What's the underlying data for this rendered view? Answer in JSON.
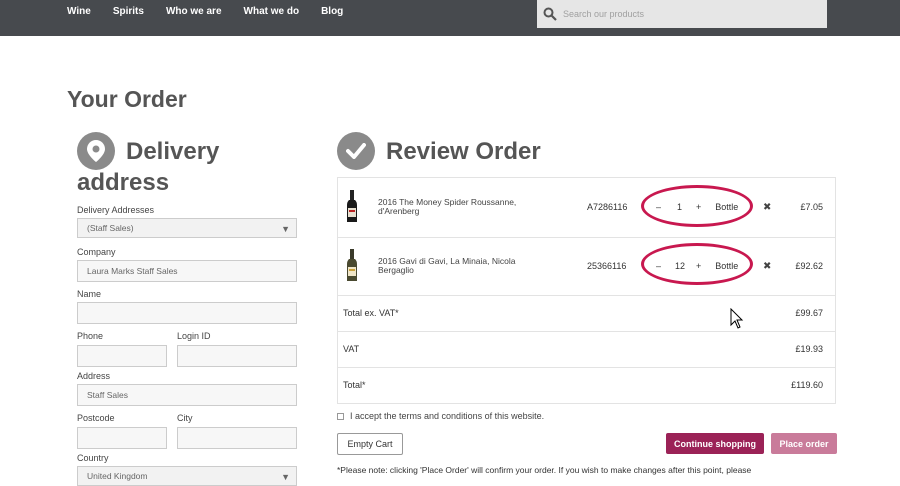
{
  "nav": {
    "items": [
      "Wine",
      "Spirits",
      "Who we are",
      "What we do",
      "Blog"
    ],
    "search_placeholder": "Search our products"
  },
  "page_title": "Your Order",
  "delivery": {
    "title_line1": "Delivery",
    "title_line2": "address",
    "addresses_label": "Delivery Addresses",
    "addresses_value": "(Staff Sales)",
    "company_label": "Company",
    "company_value": "Laura Marks Staff Sales",
    "name_label": "Name",
    "name_value": "",
    "phone_label": "Phone",
    "phone_value": "",
    "login_label": "Login ID",
    "login_value": "",
    "address_label": "Address",
    "address_value": "Staff Sales",
    "postcode_label": "Postcode",
    "postcode_value": "",
    "city_label": "City",
    "city_value": "",
    "country_label": "Country",
    "country_value": "United Kingdom"
  },
  "review": {
    "title": "Review Order",
    "items": [
      {
        "name_line1": "2016 The Money Spider Roussanne,",
        "name_line2": "d'Arenberg",
        "sku": "A7286116",
        "minus": "–",
        "qty": "1",
        "plus": "+",
        "unit": "Bottle",
        "remove": "✖",
        "price": "£7.05"
      },
      {
        "name_line1": "2016 Gavi di Gavi, La Minaia, Nicola",
        "name_line2": "Bergaglio",
        "sku": "25366116",
        "minus": "–",
        "qty": "12",
        "plus": "+",
        "unit": "Bottle",
        "remove": "✖",
        "price": "£92.62"
      }
    ],
    "totals": [
      {
        "label": "Total ex. VAT*",
        "value": "£99.67"
      },
      {
        "label": "VAT",
        "value": "£19.93"
      },
      {
        "label": "Total*",
        "value": "£119.60"
      }
    ],
    "terms": "I accept the terms and conditions of this website.",
    "empty_cart": "Empty Cart",
    "continue": "Continue shopping",
    "place_order": "Place order",
    "note": "*Please note: clicking 'Place Order' will confirm your order. If you wish to make changes after this point, please"
  },
  "colors": {
    "topbar": "#474a4e",
    "accent": "#9b2257",
    "accent_light": "#c97b9a",
    "highlight": "#c8184f"
  }
}
